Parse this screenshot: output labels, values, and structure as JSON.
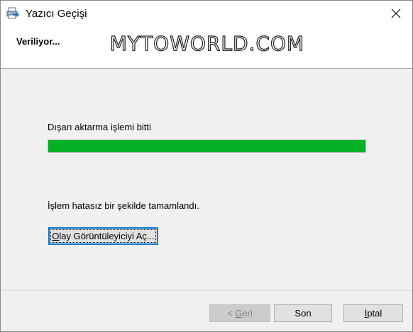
{
  "window": {
    "title": "Yazıcı Geçişi",
    "icon": "printer-migration-icon",
    "close_icon": "close-icon"
  },
  "header": {
    "title": "Veriliyor..."
  },
  "watermark": "MYTOWORLD.COM",
  "status": {
    "export_label": "Dışarı aktarma işlemi bitti",
    "progress_percent": 100,
    "progress_color": "#06b025",
    "result_text": "İşlem hatasız bir şekilde tamamlandı."
  },
  "buttons": {
    "event_viewer": {
      "mnemonic": "O",
      "rest": "lay Görüntüleyiciyi Aç..."
    },
    "back": {
      "prefix": "< ",
      "mnemonic": "G",
      "rest": "eri"
    },
    "finish": "Son",
    "cancel": {
      "mnemonic": "İ",
      "rest": "ptal"
    }
  }
}
